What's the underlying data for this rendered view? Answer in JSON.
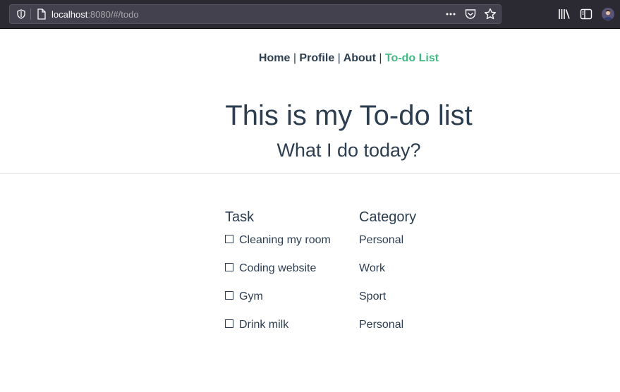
{
  "browser": {
    "url_host": "localhost",
    "url_rest": ":8080/#/todo"
  },
  "nav": {
    "items": [
      {
        "label": "Home"
      },
      {
        "label": "Profile"
      },
      {
        "label": "About"
      },
      {
        "label": "To-do List"
      }
    ],
    "separator": "|",
    "active_color": "#42b983"
  },
  "page": {
    "title": "This is my To-do list",
    "subtitle": "What I do today?"
  },
  "table": {
    "headers": [
      "Task",
      "Category"
    ],
    "rows": [
      {
        "task": "Cleaning my room",
        "category": "Personal",
        "checked": false
      },
      {
        "task": "Coding website",
        "category": "Work",
        "checked": false
      },
      {
        "task": "Gym",
        "category": "Sport",
        "checked": false
      },
      {
        "task": "Drink milk",
        "category": "Personal",
        "checked": false
      }
    ]
  },
  "icons": {
    "shield": "shield-icon",
    "page": "page-icon",
    "more": "more-icon",
    "pocket": "pocket-icon",
    "bookmark": "star-icon",
    "library": "library-icon",
    "sidebar": "sidebar-icon",
    "account": "account-avatar"
  }
}
